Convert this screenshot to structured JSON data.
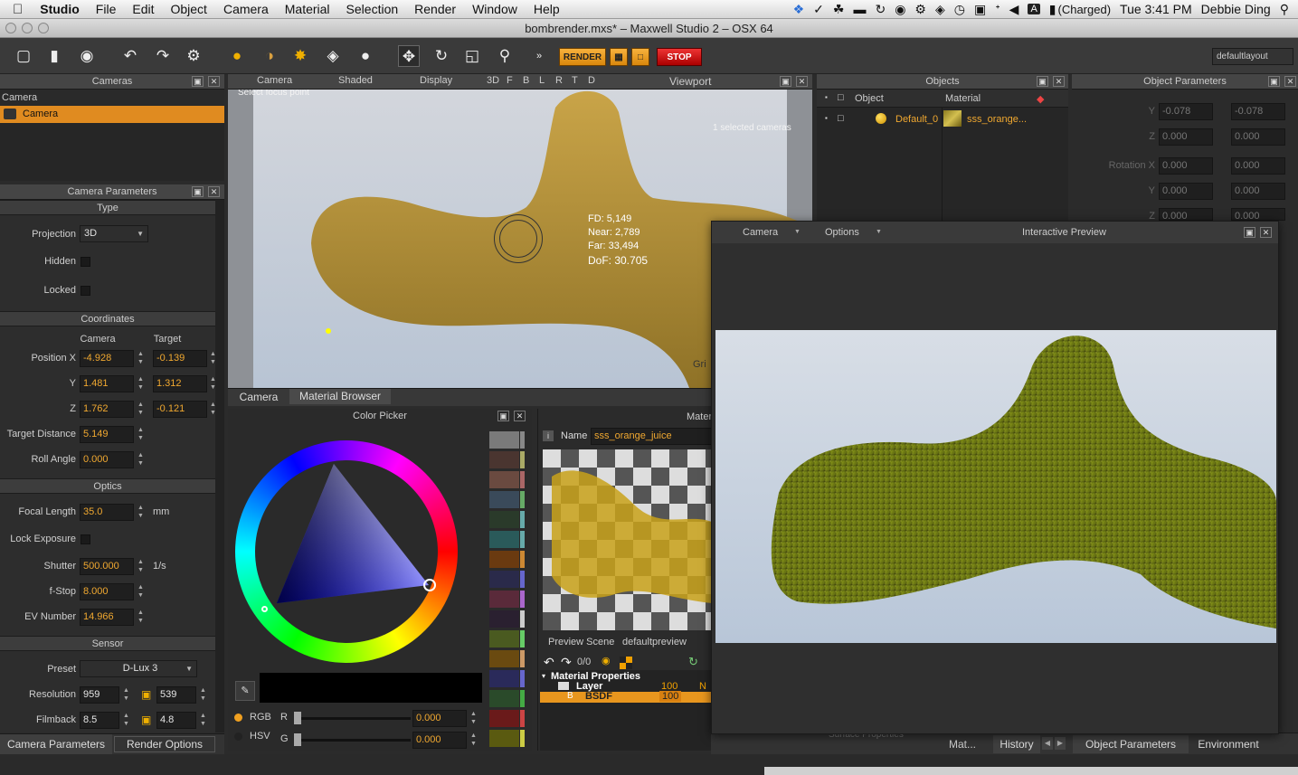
{
  "menubar": {
    "app": "Studio",
    "items": [
      "File",
      "Edit",
      "Object",
      "Camera",
      "Material",
      "Selection",
      "Render",
      "Window",
      "Help"
    ],
    "battery": "(Charged)",
    "clock": "Tue 3:41 PM",
    "user": "Debbie Ding",
    "input_letter": "A"
  },
  "window": {
    "title": "bombrender.mxs* – Maxwell Studio 2 – OSX 64"
  },
  "toolbar": {
    "render_label": "RENDER",
    "stop_label": "STOP",
    "layout_label": "defaultlayout"
  },
  "cameras_panel": {
    "title": "Cameras",
    "column": "Camera",
    "selected": "Camera"
  },
  "camera_params": {
    "title": "Camera Parameters",
    "type_section": "Type",
    "projection_label": "Projection",
    "projection_value": "3D",
    "hidden_label": "Hidden",
    "locked_label": "Locked",
    "coordinates_section": "Coordinates",
    "col_camera": "Camera",
    "col_target": "Target",
    "posx_label": "Position X",
    "posx_cam": "-4.928",
    "posx_tgt": "-0.139",
    "y_label": "Y",
    "y_cam": "1.481",
    "y_tgt": "1.312",
    "z_label": "Z",
    "z_cam": "1.762",
    "z_tgt": "-0.121",
    "target_distance_label": "Target Distance",
    "target_distance": "5.149",
    "roll_label": "Roll Angle",
    "roll": "0.000",
    "optics_section": "Optics",
    "focal_label": "Focal Length",
    "focal": "35.0",
    "focal_unit": "mm",
    "lock_exposure_label": "Lock Exposure",
    "shutter_label": "Shutter",
    "shutter": "500.000",
    "shutter_unit": "1/s",
    "fstop_label": "f-Stop",
    "fstop": "8.000",
    "ev_label": "EV Number",
    "ev": "14.966",
    "sensor_section": "Sensor",
    "preset_label": "Preset",
    "preset": "D-Lux 3",
    "resolution_label": "Resolution",
    "res_w": "959",
    "res_h": "539",
    "filmback_label": "Filmback",
    "film_w": "8.5",
    "film_h": "4.8"
  },
  "left_tabs": [
    "Camera Parameters",
    "Render Options"
  ],
  "viewport": {
    "menus": [
      "Camera",
      "Shaded",
      "Display"
    ],
    "view_buttons": [
      "3D",
      "F",
      "B",
      "L",
      "R",
      "T",
      "D"
    ],
    "title": "Viewport",
    "hint": "Select focus point",
    "selected_info": "1 selected cameras",
    "fd": "FD: 5,149",
    "near": "Near: 2,789",
    "far": "Far: 33,494",
    "dof": "DoF: 30.705",
    "grid_label": "Gri"
  },
  "mid_tabs": [
    "Camera",
    "Material Browser"
  ],
  "color_picker": {
    "title": "Color Picker",
    "modes": [
      "RGB",
      "HSV"
    ],
    "channel_r": "R",
    "channel_g": "G",
    "r_value": "0.000",
    "g_value": "0.000",
    "swatch_colors": [
      "#7a7a7a",
      "#4a3530",
      "#6a4a40",
      "#3a4a5a",
      "#2a3a2a",
      "#2a5a5a",
      "#6a3a10",
      "#2a2a4a",
      "#5a2a3a",
      "#2a2030",
      "#4a5a20",
      "#6a4a10",
      "#2a2a5a",
      "#2a4a2a",
      "#6a1a1a",
      "#5a5a10"
    ],
    "swatch_edges": [
      "#888",
      "#aa6",
      "#a66",
      "#6a6",
      "#6aa",
      "#6aa",
      "#c83",
      "#66c",
      "#a6c",
      "#ccc",
      "#6c6",
      "#c96",
      "#66c",
      "#4a4",
      "#c44",
      "#cc4"
    ]
  },
  "material_editor": {
    "header": "Mater",
    "name_label": "Name",
    "name_value": "sss_orange_juice",
    "preview_scene_label": "Preview Scene",
    "preview_scene_value": "defaultpreview",
    "counter": "0/0",
    "tree_root": "Material Properties",
    "tree_layer": "Layer",
    "tree_bsdf": "BSDF",
    "layer_weight": "100",
    "bsdf_weight": "100",
    "layer_n": "N"
  },
  "objects_panel": {
    "title": "Objects",
    "col_object": "Object",
    "col_material": "Material",
    "row_object": "Default_0",
    "row_material": "sss_orange..."
  },
  "object_params": {
    "title": "Object Parameters",
    "y_label": "Y",
    "y_a": "-0.078",
    "y_b": "-0.078",
    "z_label": "Z",
    "z_a": "0.000",
    "z_b": "0.000",
    "rotx_label": "Rotation X",
    "rotx_a": "0.000",
    "rotx_b": "0.000",
    "ry_label": "Y",
    "ry_a": "0.000",
    "ry_b": "0.000",
    "rz_label": "Z",
    "rz_a": "0.000",
    "rz_b": "0.000"
  },
  "interactive_preview": {
    "camera_menu": "Camera",
    "options_menu": "Options",
    "title": "Interactive Preview"
  },
  "right_tabs": [
    "Mat...",
    "History",
    "Object Parameters",
    "Environment"
  ],
  "surface_props": "Surface Properties"
}
